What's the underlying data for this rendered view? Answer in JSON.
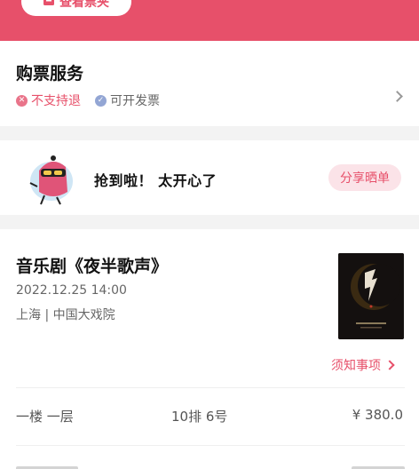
{
  "header": {
    "view_seat_label": "查看票夹",
    "brand_color": "#e7506a"
  },
  "service": {
    "title": "购票服务",
    "items": [
      {
        "icon": "x-circle-icon",
        "label": "不支持退"
      },
      {
        "icon": "check-circle-icon",
        "label": "可开发票"
      }
    ]
  },
  "share": {
    "message": "抢到啦！ 太开心了",
    "button_label": "分享晒单"
  },
  "show": {
    "title": "音乐剧《夜半歌声》",
    "datetime": "2022.12.25 14:00",
    "venue": "上海 | 中国大戏院",
    "notice_label": "须知事项",
    "ticket": {
      "area": "一楼 一层",
      "seat": "10排 6号",
      "price": "¥ 380.0"
    }
  }
}
